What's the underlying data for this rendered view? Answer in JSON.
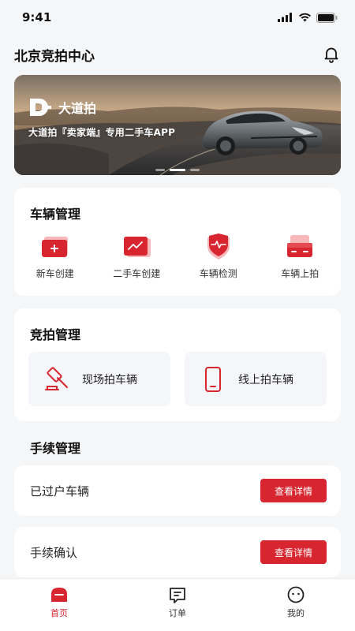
{
  "status_bar": {
    "time": "9:41"
  },
  "header": {
    "title": "北京竞拍中心"
  },
  "banner": {
    "brand": "大道拍",
    "subtitle": "大道拍『卖家端』专用二手车APP"
  },
  "vehicle_management": {
    "title": "车辆管理",
    "items": [
      {
        "label": "新车创建",
        "icon": "new-car-box-icon"
      },
      {
        "label": "二手车创建",
        "icon": "chart-board-icon"
      },
      {
        "label": "车辆检测",
        "icon": "shield-pulse-icon"
      },
      {
        "label": "车辆上拍",
        "icon": "box-upload-icon"
      }
    ]
  },
  "auction_management": {
    "title": "竞拍管理",
    "tiles": [
      {
        "label": "现场拍车辆",
        "icon": "gavel-icon"
      },
      {
        "label": "线上拍车辆",
        "icon": "phone-icon"
      }
    ]
  },
  "procedures": {
    "title": "手续管理",
    "rows": [
      {
        "label": "已过户车辆",
        "button": "查看详情"
      },
      {
        "label": "手续确认",
        "button": "查看详情"
      }
    ]
  },
  "tab_bar": {
    "tabs": [
      {
        "label": "首页",
        "active": true,
        "icon": "home-icon"
      },
      {
        "label": "订单",
        "active": false,
        "icon": "order-icon"
      },
      {
        "label": "我的",
        "active": false,
        "icon": "profile-icon"
      }
    ]
  },
  "colors": {
    "accent": "#d7262f",
    "background": "#f5f6f8"
  }
}
